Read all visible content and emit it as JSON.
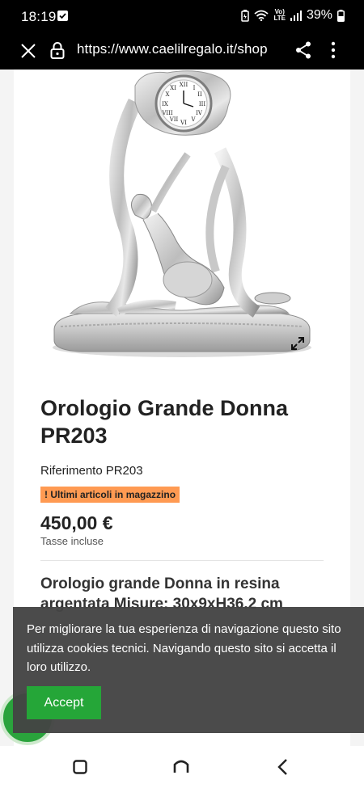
{
  "status_bar": {
    "time": "18:19",
    "network_top": "Vo)",
    "network_bottom": "LTE",
    "battery": "39%",
    "icons": [
      "checkbox-notification-icon",
      "battery-saver-icon",
      "wifi-icon",
      "volte-icon",
      "signal-icon",
      "battery-icon"
    ]
  },
  "browser": {
    "url": "https://www.caelilregalo.it/shop",
    "icons": [
      "close-icon",
      "lock-icon",
      "share-icon",
      "more-vert-icon"
    ]
  },
  "product": {
    "title": "Orologio Grande Donna PR203",
    "reference_label": "Riferimento",
    "reference_value": "PR203",
    "stock_badge": "Ultimi articoli in magazzino",
    "price": "450,00 €",
    "tax_note": "Tasse incluse",
    "description": "Orologio grande Donna in resina argentata Misure: 30x9xH36.2 cm",
    "image_alt": "silver clock with woman figurine"
  },
  "cookie_banner": {
    "text": "Per migliorare la tua esperienza di navigazione questo sito utilizza cookies tecnici. Navigando questo sito si accetta il loro utilizzo.",
    "accept_label": "Accept",
    "accent_color": "#25a638"
  },
  "nav_bar": {
    "icons": [
      "recents-icon",
      "home-icon",
      "back-icon"
    ]
  }
}
